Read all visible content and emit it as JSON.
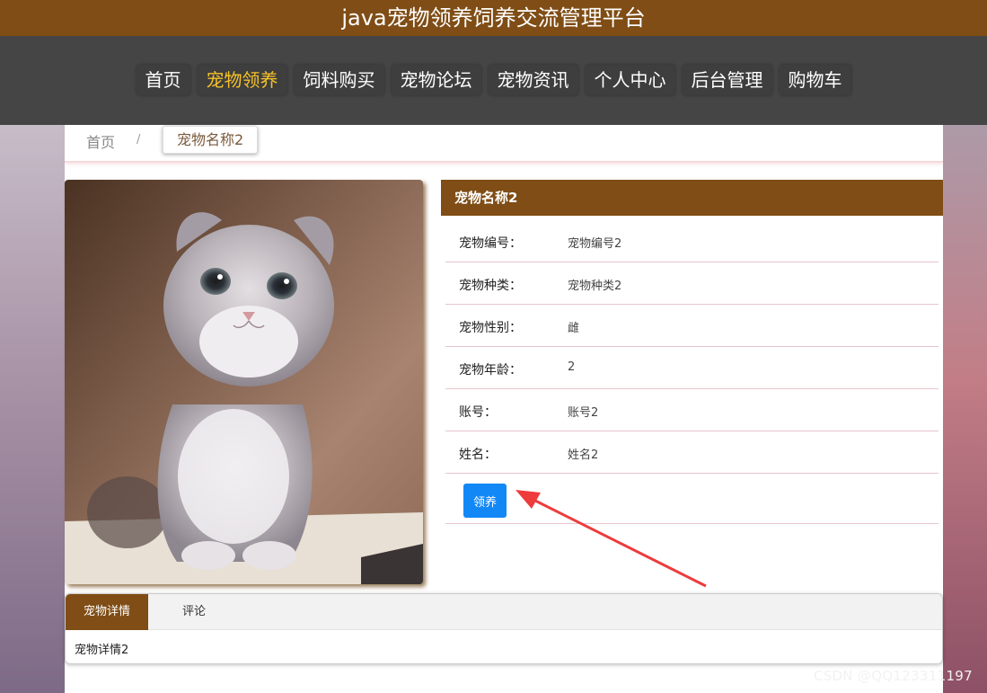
{
  "app": {
    "title": "java宠物领养饲养交流管理平台"
  },
  "nav": {
    "items": [
      {
        "label": "首页"
      },
      {
        "label": "宠物领养",
        "active": true
      },
      {
        "label": "饲料购买"
      },
      {
        "label": "宠物论坛"
      },
      {
        "label": "宠物资讯"
      },
      {
        "label": "个人中心"
      },
      {
        "label": "后台管理"
      },
      {
        "label": "购物车"
      }
    ],
    "active_color": "#f6c228"
  },
  "breadcrumb": {
    "home": "首页",
    "separator": "/",
    "current": "宠物名称2"
  },
  "pet": {
    "name": "宠物名称2",
    "photo_icon": "kitten-photo",
    "fields": [
      {
        "key": "宠物编号：",
        "value": "宠物编号2"
      },
      {
        "key": "宠物种类：",
        "value": "宠物种类2"
      },
      {
        "key": "宠物性别：",
        "value": "雌"
      },
      {
        "key": "宠物年龄：",
        "value": "2"
      },
      {
        "key": "账号：",
        "value": "账号2"
      },
      {
        "key": "姓名：",
        "value": "姓名2"
      }
    ],
    "adopt_label": "领养"
  },
  "tabs": {
    "items": [
      {
        "label": "宠物详情",
        "active": true
      },
      {
        "label": "评论"
      }
    ],
    "content": "宠物详情2"
  },
  "watermark": "CSDN @QQ123311197",
  "colors": {
    "brand": "#7f4d15",
    "nav_bg": "#454545",
    "button": "#1288f6",
    "arrow": "#ee3b3b"
  }
}
